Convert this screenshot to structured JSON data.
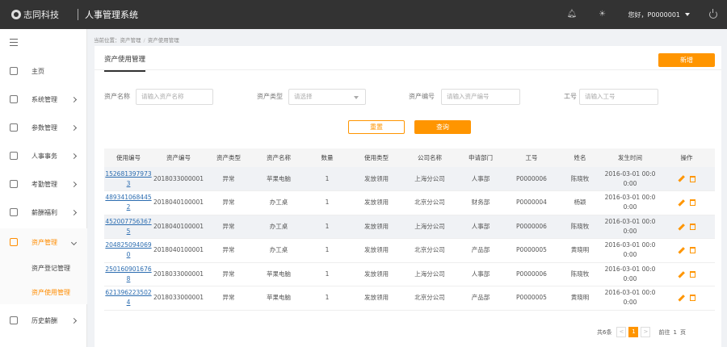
{
  "header": {
    "logo_text": "志同科技",
    "system_title": "人事管理系统",
    "greeting": "您好，P0000001"
  },
  "sidebar": {
    "items": [
      {
        "label": "主页",
        "icon": "home-icon"
      },
      {
        "label": "系统管理",
        "icon": "monitor-icon"
      },
      {
        "label": "参数管理",
        "icon": "document-icon"
      },
      {
        "label": "人事事务",
        "icon": "people-icon"
      },
      {
        "label": "考勤管理",
        "icon": "briefcase-icon"
      },
      {
        "label": "薪酬福利",
        "icon": "copy-icon"
      },
      {
        "label": "资产管理",
        "icon": "asset-icon"
      },
      {
        "label": "历史薪酬",
        "icon": "archive-icon"
      }
    ],
    "sub_items": [
      {
        "label": "资产登记管理"
      },
      {
        "label": "资产使用管理"
      }
    ],
    "accent": "#ff8c00"
  },
  "breadcrumb": {
    "prefix": "当前位置：",
    "parent": "资产管理",
    "current": "资产使用管理"
  },
  "page": {
    "tab_label": "资产使用管理",
    "add_button": "新增"
  },
  "filters": {
    "asset_name_label": "资产名称",
    "asset_name_placeholder": "请输入资产名称",
    "asset_type_label": "资产类型",
    "asset_type_placeholder": "请选择",
    "asset_no_label": "资产编号",
    "asset_no_placeholder": "请输入资产编号",
    "job_no_label": "工号",
    "job_no_placeholder": "请输入工号",
    "reset_button": "重置",
    "query_button": "查询"
  },
  "table": {
    "headers": [
      "使用编号",
      "资产编号",
      "资产类型",
      "资产名称",
      "数量",
      "使用类型",
      "公司名称",
      "申请部门",
      "工号",
      "姓名",
      "发生时间",
      "操作"
    ],
    "rows": [
      [
        "1526813979733",
        "2018033000001",
        "异常",
        "苹果电脑",
        "1",
        "发放领用",
        "上海分公司",
        "人事部",
        "P0000006",
        "陈晓牧",
        "2016-03-01 00:00:00"
      ],
      [
        "4893410684452",
        "2018040100001",
        "异常",
        "办工桌",
        "1",
        "发放领用",
        "北京分公司",
        "财务部",
        "P0000004",
        "杨颖",
        "2016-03-01 00:00:00"
      ],
      [
        "4520077563675",
        "2018040100001",
        "异常",
        "办工桌",
        "1",
        "发放领用",
        "上海分公司",
        "人事部",
        "P0000006",
        "陈晓牧",
        "2016-03-01 00:00:00"
      ],
      [
        "2048250940690",
        "2018040100001",
        "异常",
        "办工桌",
        "1",
        "发放领用",
        "北京分公司",
        "产品部",
        "P0000005",
        "黄晓明",
        "2016-03-01 00:00:00"
      ],
      [
        "2501609016768",
        "2018033000001",
        "异常",
        "苹果电脑",
        "1",
        "发放领用",
        "上海分公司",
        "人事部",
        "P0000006",
        "陈晓牧",
        "2016-03-01 00:00:00"
      ],
      [
        "6213962235024",
        "2018033000001",
        "异常",
        "苹果电脑",
        "1",
        "发放领用",
        "北京分公司",
        "产品部",
        "P0000005",
        "黄晓明",
        "2016-03-01 00:00:00"
      ]
    ]
  },
  "pagination": {
    "total_text": "共6条",
    "current_page": "1",
    "goto_label": "前往",
    "goto_value": "1",
    "page_suffix": "页"
  },
  "colors": {
    "accent": "#ff9500",
    "topbar": "#333333",
    "link": "#2b6cb0"
  }
}
